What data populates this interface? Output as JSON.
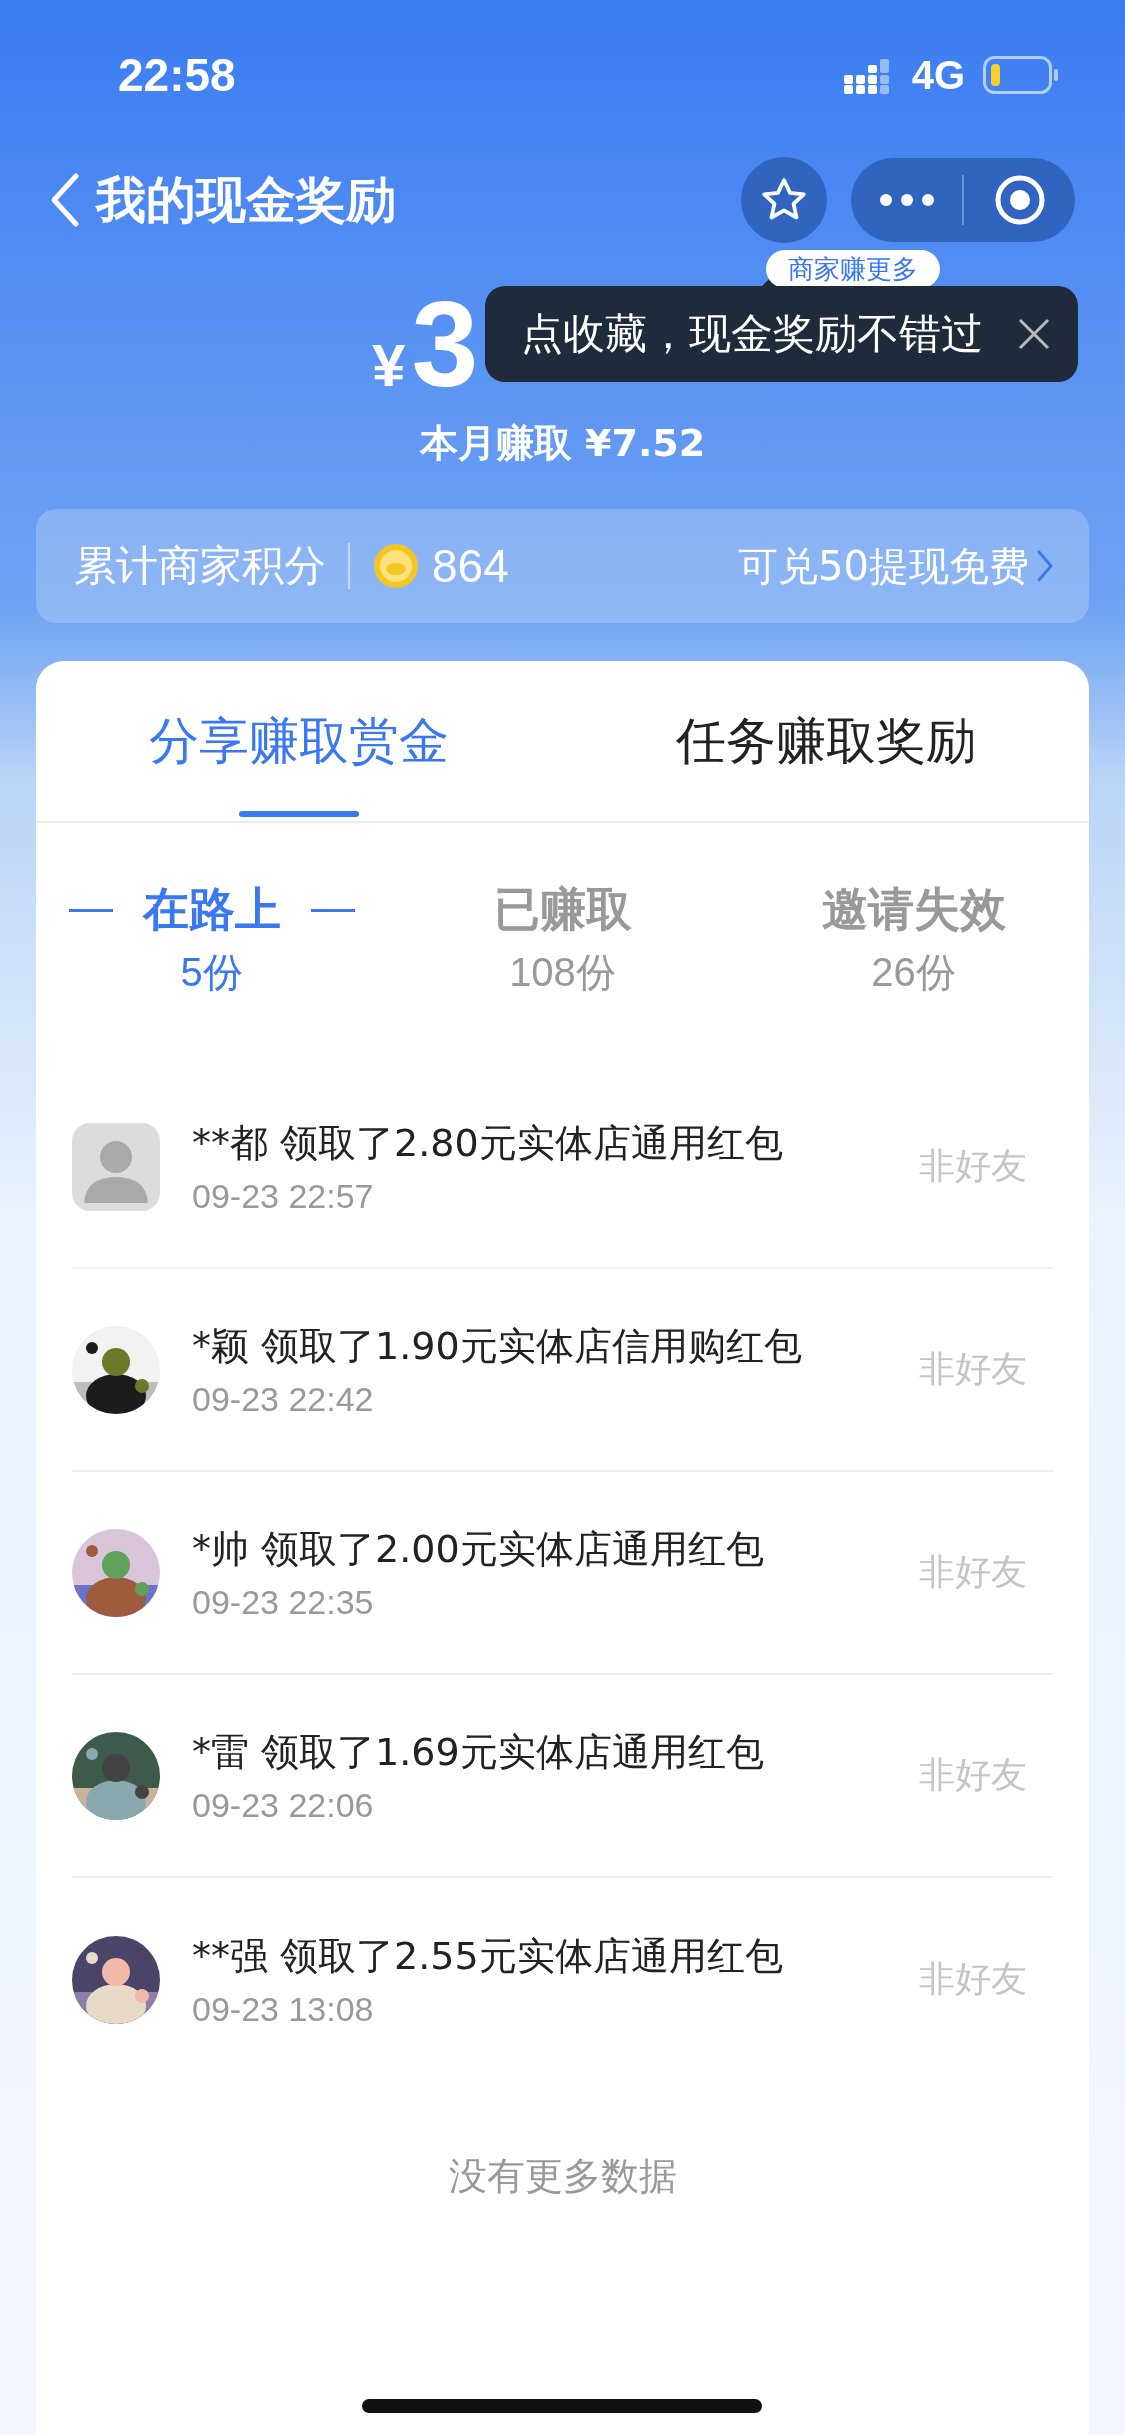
{
  "status_bar": {
    "time": "22:58",
    "network": "4G"
  },
  "nav": {
    "title": "我的现金奖励"
  },
  "balance": {
    "currency": "¥",
    "amount": "3",
    "month": "本月赚取 ¥7.52"
  },
  "favorite_tip": {
    "badge": "商家赚更多",
    "text": "点收藏，现金奖励不错过"
  },
  "points": {
    "label": "累计商家积分",
    "value": "864",
    "link": "可兑50提现免费"
  },
  "tabs": [
    {
      "label": "分享赚取赏金",
      "selected": true
    },
    {
      "label": "任务赚取奖励",
      "selected": false
    }
  ],
  "segments": [
    {
      "label": "在路上",
      "count": "5份",
      "selected": true
    },
    {
      "label": "已赚取",
      "count": "108份",
      "selected": false
    },
    {
      "label": "邀请失效",
      "count": "26份",
      "selected": false
    }
  ],
  "records": [
    {
      "avatar": {
        "kind": "default"
      },
      "text": "**都 领取了2.80元实体店通用红包",
      "time": "09-23 22:57",
      "status": "非好友"
    },
    {
      "text": "*颖 领取了1.90元实体店信用购红包",
      "time": "09-23 22:42",
      "status": "非好友"
    },
    {
      "text": "*帅 领取了2.00元实体店通用红包",
      "time": "09-23 22:35",
      "status": "非好友"
    },
    {
      "text": "*雷 领取了1.69元实体店通用红包",
      "time": "09-23 22:06",
      "status": "非好友"
    },
    {
      "text": "**强 领取了2.55元实体店通用红包",
      "time": "09-23 13:08",
      "status": "非好友"
    }
  ],
  "footer": "没有更多数据"
}
